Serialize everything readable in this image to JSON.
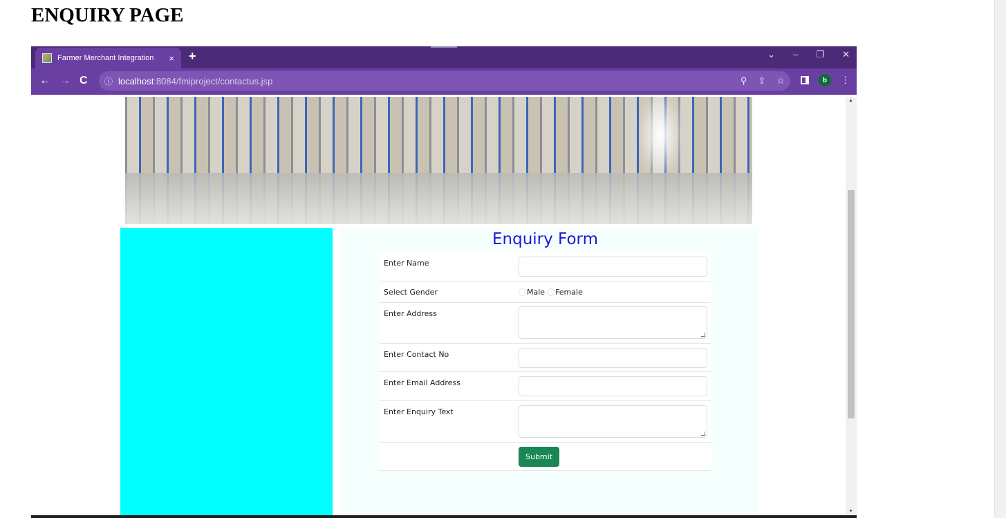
{
  "page": {
    "heading": "ENQUIRY PAGE"
  },
  "browser": {
    "tab": {
      "title": "Farmer Merchant Integration",
      "close_glyph": "×",
      "favicon": "farm-favicon"
    },
    "new_tab_glyph": "+",
    "window_controls": [
      "⌄",
      "–",
      "❐",
      "✕"
    ],
    "nav": {
      "back": "←",
      "forward": "→",
      "reload": "C"
    },
    "address": {
      "host": "localhost",
      "path": ":8084/fmiproject/contactus.jsp",
      "info_icon": "ⓘ"
    },
    "omni_icons": [
      "⚲",
      "⇪",
      "☆"
    ],
    "profile_initial": "b",
    "menu_glyph": "⋮",
    "accent_color": "#6a3fa2"
  },
  "form": {
    "title": "Enquiry Form",
    "fields": {
      "name_label": "Enter Name",
      "gender_label": "Select Gender",
      "gender_options": [
        "Male",
        "Female"
      ],
      "address_label": "Enter Address",
      "contact_label": "Enter Contact No",
      "email_label": "Enter Email Address",
      "enquiry_label": "Enter Enquiry Text"
    },
    "submit_label": "Submit",
    "title_color": "#1d18d6",
    "submit_color": "#198754",
    "side_panel_color": "#00ffff"
  }
}
